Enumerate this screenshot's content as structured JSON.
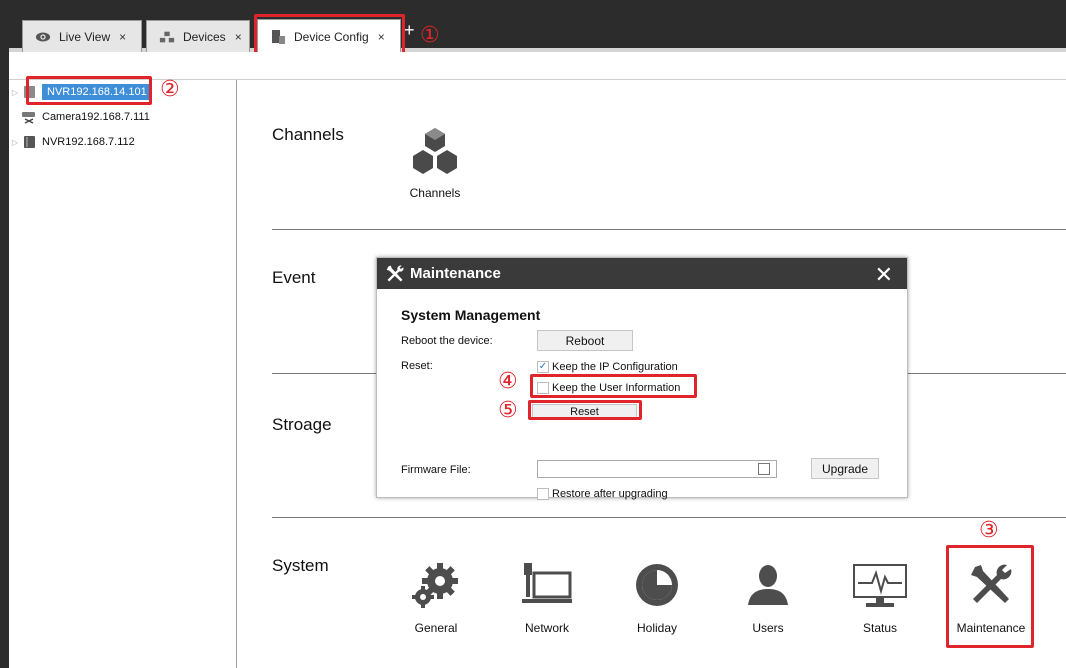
{
  "tabs": [
    {
      "label": "Live View",
      "icon": "eye-icon"
    },
    {
      "label": "Devices",
      "icon": "devices-icon"
    },
    {
      "label": "Device Config",
      "icon": "device-config-icon",
      "active": true
    }
  ],
  "tab_close_glyph": "×",
  "tab_add_glyph": "+",
  "tree": [
    {
      "label": "NVR192.168.14.101",
      "icon": "nvr-icon",
      "selected": true,
      "expandable": true
    },
    {
      "label": "Camera192.168.7.111",
      "icon": "camera-icon",
      "selected": false,
      "expandable": false
    },
    {
      "label": "NVR192.168.7.112",
      "icon": "nvr-icon",
      "selected": false,
      "expandable": true
    }
  ],
  "sections": {
    "channels": {
      "title": "Channels",
      "items": [
        {
          "label": "Channels",
          "icon": "channels-icon"
        }
      ]
    },
    "event": {
      "title": "Event"
    },
    "storage": {
      "title": "Stroage"
    },
    "system": {
      "title": "System",
      "items": [
        {
          "label": "General",
          "icon": "gears-icon"
        },
        {
          "label": "Network",
          "icon": "network-icon"
        },
        {
          "label": "Holiday",
          "icon": "holiday-icon"
        },
        {
          "label": "Users",
          "icon": "user-icon"
        },
        {
          "label": "Status",
          "icon": "status-monitor-icon"
        },
        {
          "label": "Maintenance",
          "icon": "tools-icon"
        }
      ]
    }
  },
  "dialog": {
    "title": "Maintenance",
    "close_glyph": "✕",
    "heading": "System Management",
    "reboot_label": "Reboot the device:",
    "reboot_button": "Reboot",
    "reset_label": "Reset:",
    "keep_ip": {
      "label": "Keep the IP Configuration",
      "checked": true
    },
    "keep_user": {
      "label": "Keep the User Information",
      "checked": false
    },
    "reset_button": "Reset",
    "firmware_label": "Firmware File:",
    "firmware_value": "",
    "upgrade_button": "Upgrade",
    "restore_after": {
      "label": "Restore after upgrading",
      "checked": false
    }
  },
  "annotations": [
    "①",
    "②",
    "③",
    "④",
    "⑤"
  ],
  "colors": {
    "highlight": "#e0242b",
    "selection": "#3f8ed8",
    "header": "#2c2c2c"
  }
}
